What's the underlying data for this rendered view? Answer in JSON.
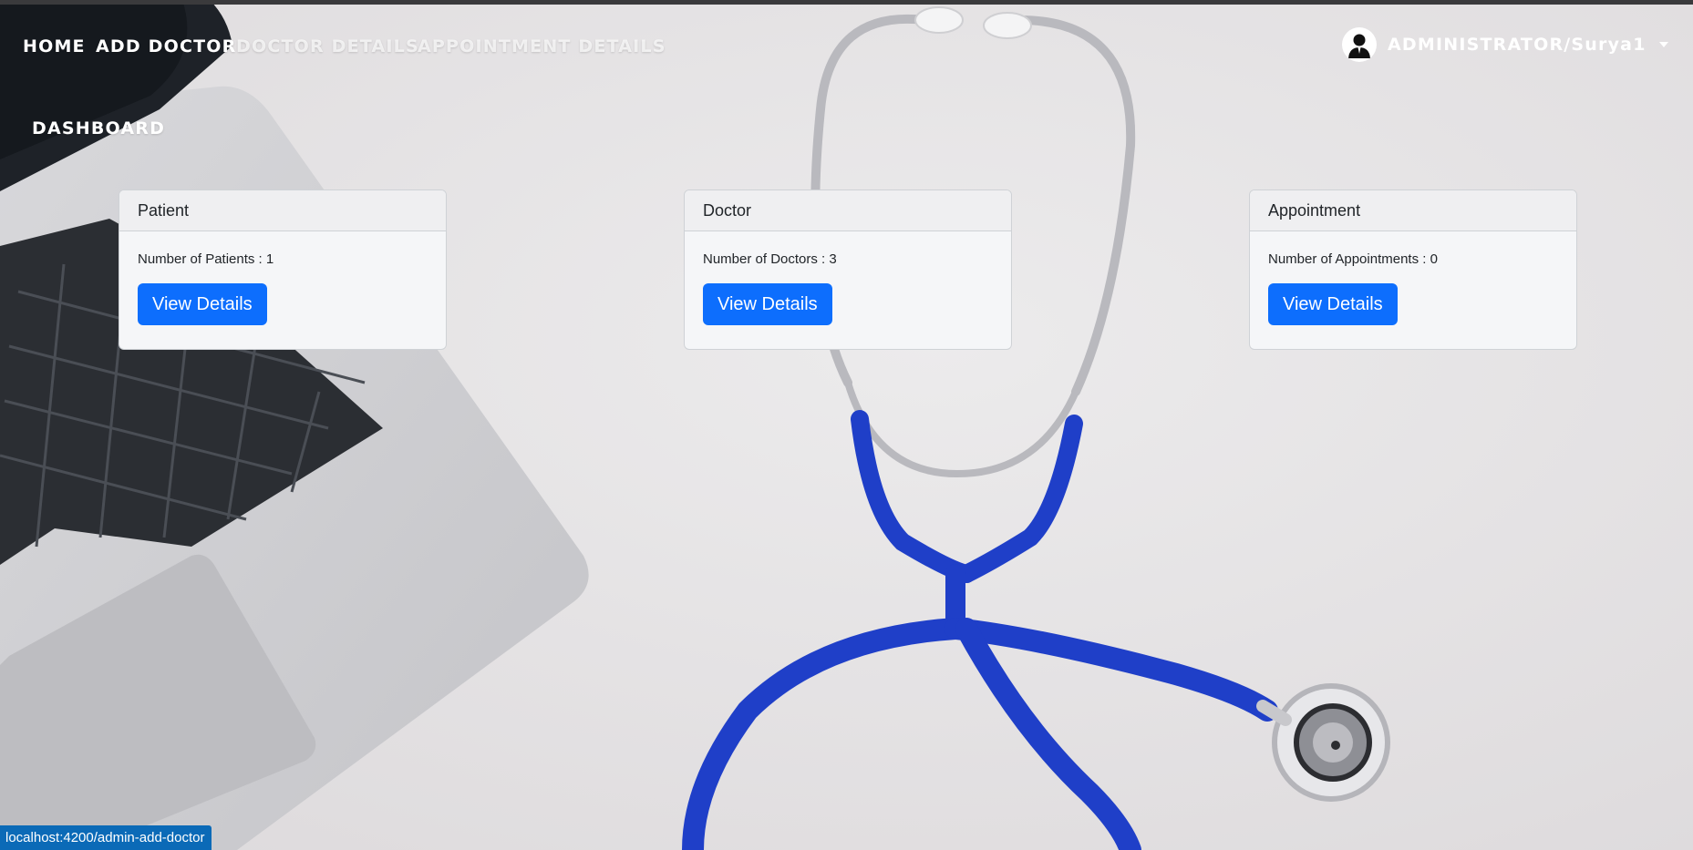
{
  "navbar": {
    "links": [
      {
        "label": "HOME"
      },
      {
        "label": "ADD DOCTOR"
      },
      {
        "label": "DOCTOR DETAILS"
      },
      {
        "label": "APPOINTMENT DETAILS"
      },
      {
        "label": "DASHBOARD"
      }
    ],
    "user": {
      "label": "ADMINISTRATOR/Surya1",
      "avatar_icon": "user-silhouette-icon"
    }
  },
  "cards": [
    {
      "title": "Patient",
      "text": "Number of Patients : 1",
      "button": "View Details"
    },
    {
      "title": "Doctor",
      "text": "Number of Doctors : 3",
      "button": "View Details"
    },
    {
      "title": "Appointment",
      "text": "Number of Appointments : 0",
      "button": "View Details"
    }
  ],
  "status_bar": {
    "url": "localhost:4200/admin-add-doctor"
  },
  "colors": {
    "primary_button": "#0d6efd",
    "status_bar": "#0b6ab7"
  }
}
